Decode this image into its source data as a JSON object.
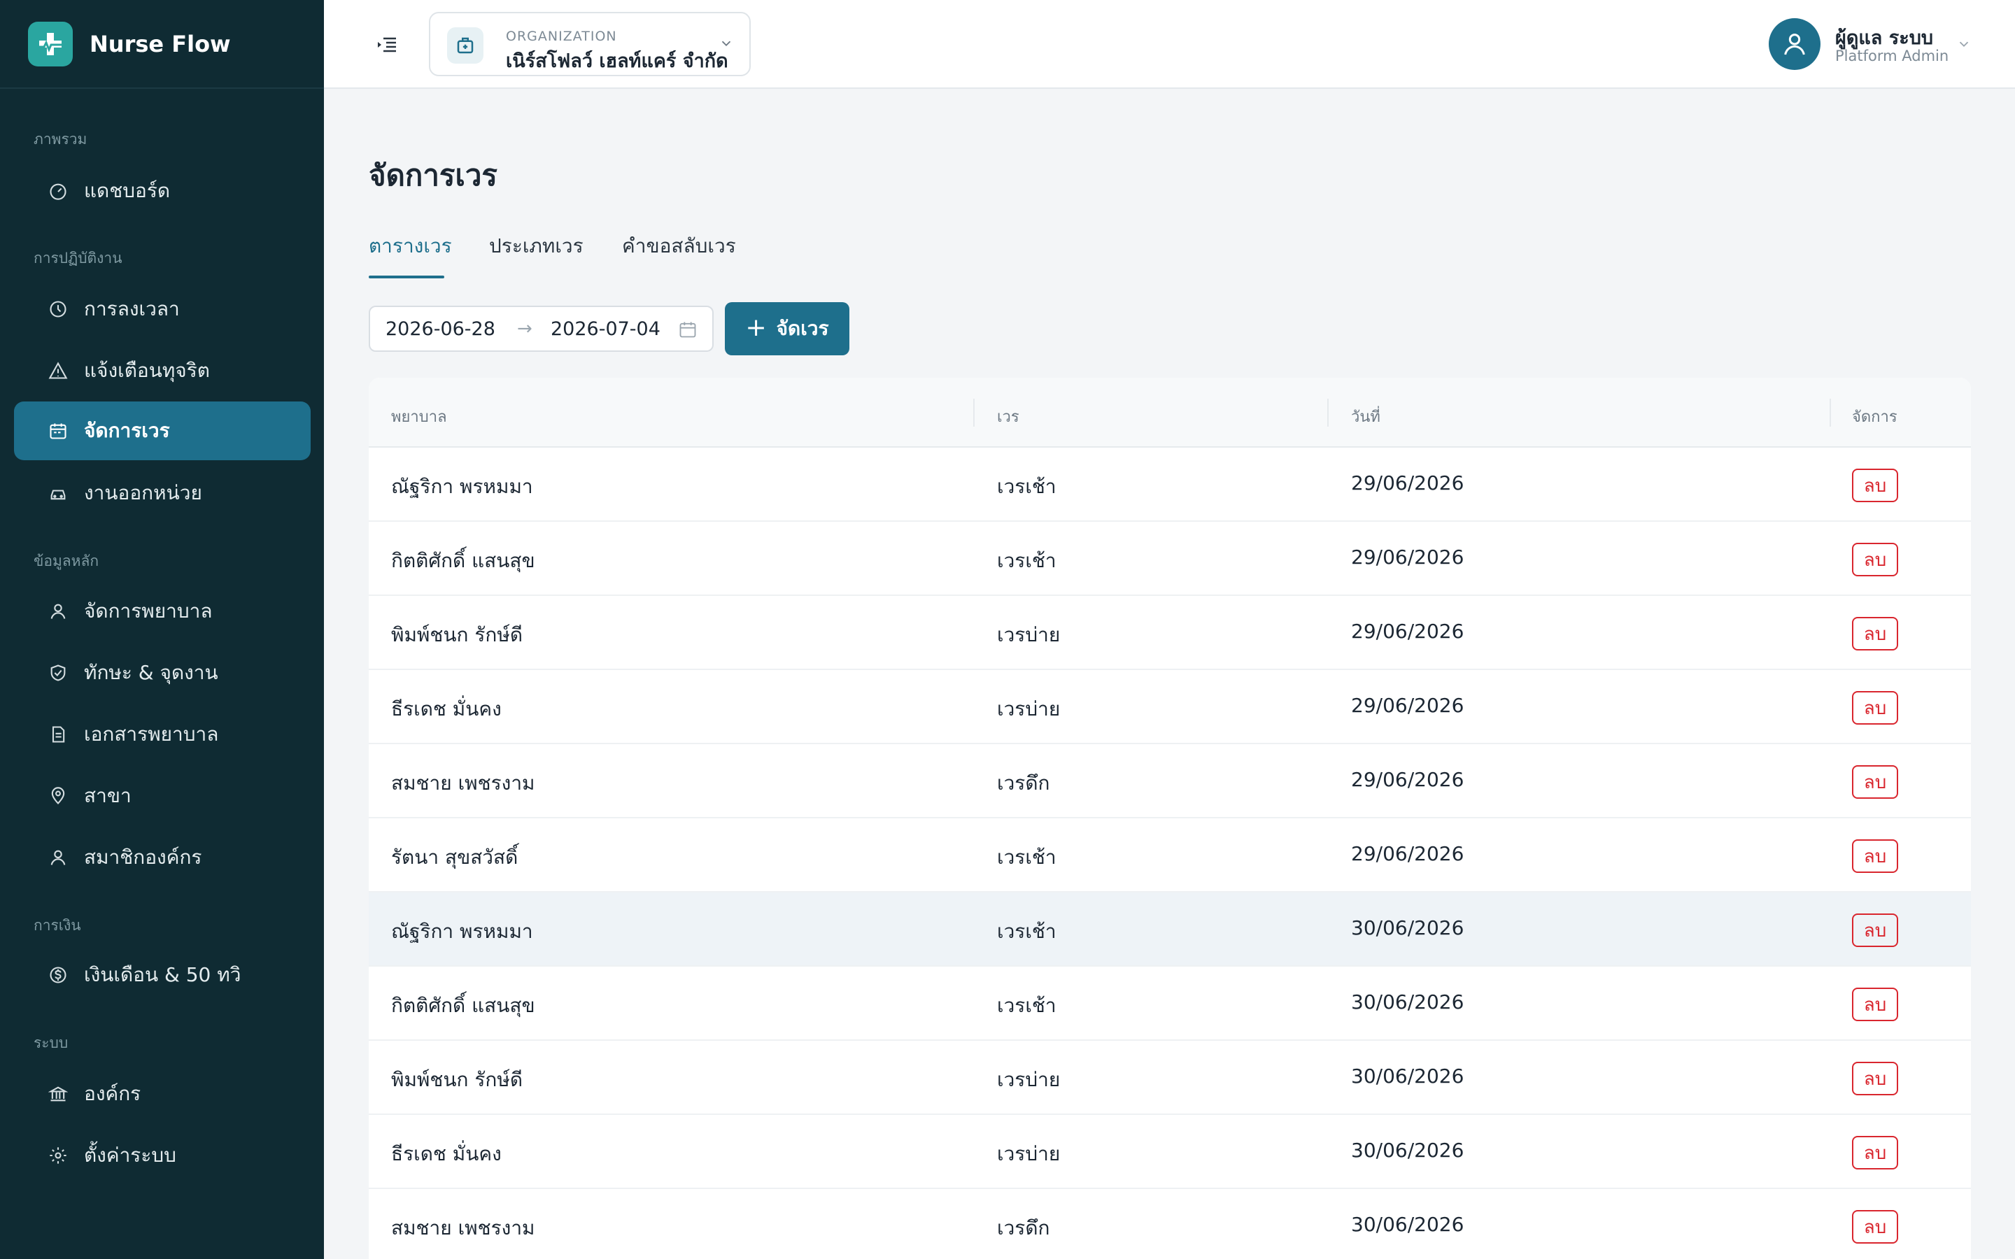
{
  "brand": {
    "name": "Nurse Flow"
  },
  "sidebar": {
    "sections": [
      {
        "label": "ภาพรวม"
      },
      {
        "label": "การปฏิบัติงาน"
      },
      {
        "label": "ข้อมูลหลัก"
      },
      {
        "label": "การเงิน"
      },
      {
        "label": "ระบบ"
      }
    ],
    "items": [
      {
        "label": "แดชบอร์ด",
        "icon": "dashboard-gauge-icon"
      },
      {
        "label": "การลงเวลา",
        "icon": "clock-icon"
      },
      {
        "label": "แจ้งเตือนทุจริต",
        "icon": "warning-triangle-icon"
      },
      {
        "label": "จัดการเวร",
        "icon": "calendar-icon",
        "active": true
      },
      {
        "label": "งานออกหน่วย",
        "icon": "car-icon"
      },
      {
        "label": "จัดการพยาบาล",
        "icon": "nurse-user-icon"
      },
      {
        "label": "ทักษะ & จุดงาน",
        "icon": "shield-check-icon"
      },
      {
        "label": "เอกสารพยาบาล",
        "icon": "document-icon"
      },
      {
        "label": "สาขา",
        "icon": "map-pin-icon"
      },
      {
        "label": "สมาชิกองค์กร",
        "icon": "members-icon"
      },
      {
        "label": "เงินเดือน & 50 ทวิ",
        "icon": "dollar-circle-icon"
      },
      {
        "label": "องค์กร",
        "icon": "bank-building-icon"
      },
      {
        "label": "ตั้งค่าระบบ",
        "icon": "gear-icon"
      }
    ]
  },
  "topbar": {
    "org_label": "ORGANIZATION",
    "org_name": "เนิร์สโฟลว์ เฮลท์แคร์ จำกัด",
    "user_name": "ผู้ดูแล ระบบ",
    "user_role": "Platform Admin"
  },
  "page": {
    "title": "จัดการเวร",
    "tabs": [
      {
        "label": "ตารางเวร",
        "active": true
      },
      {
        "label": "ประเภทเวร"
      },
      {
        "label": "คำขอสลับเวร"
      }
    ],
    "date_start": "2026-06-28",
    "date_arrow": "→",
    "date_end": "2026-07-04",
    "add_button": "จัดเวร",
    "add_icon": "+"
  },
  "colors": {
    "sidebar_bg": "#0f2b33",
    "accent": "#1e6f8c",
    "danger": "#d9262e"
  },
  "table": {
    "headers": {
      "nurse": "พยาบาล",
      "shift": "เวร",
      "date": "วันที่",
      "actions": "จัดการ"
    },
    "delete_label": "ลบ",
    "rows": [
      {
        "nurse": "ณัฐริกา พรหมมา",
        "shift": "เวรเช้า",
        "date": "29/06/2026"
      },
      {
        "nurse": "กิตติศักดิ์ แสนสุข",
        "shift": "เวรเช้า",
        "date": "29/06/2026"
      },
      {
        "nurse": "พิมพ์ชนก รักษ์ดี",
        "shift": "เวรบ่าย",
        "date": "29/06/2026"
      },
      {
        "nurse": "ธีรเดช มั่นคง",
        "shift": "เวรบ่าย",
        "date": "29/06/2026"
      },
      {
        "nurse": "สมชาย เพชรงาม",
        "shift": "เวรดึก",
        "date": "29/06/2026"
      },
      {
        "nurse": "รัตนา สุขสวัสดิ์",
        "shift": "เวรเช้า",
        "date": "29/06/2026"
      },
      {
        "nurse": "ณัฐริกา พรหมมา",
        "shift": "เวรเช้า",
        "date": "30/06/2026",
        "highlight": true
      },
      {
        "nurse": "กิตติศักดิ์ แสนสุข",
        "shift": "เวรเช้า",
        "date": "30/06/2026"
      },
      {
        "nurse": "พิมพ์ชนก รักษ์ดี",
        "shift": "เวรบ่าย",
        "date": "30/06/2026"
      },
      {
        "nurse": "ธีรเดช มั่นคง",
        "shift": "เวรบ่าย",
        "date": "30/06/2026"
      },
      {
        "nurse": "สมชาย เพชรงาม",
        "shift": "เวรดึก",
        "date": "30/06/2026"
      }
    ]
  }
}
